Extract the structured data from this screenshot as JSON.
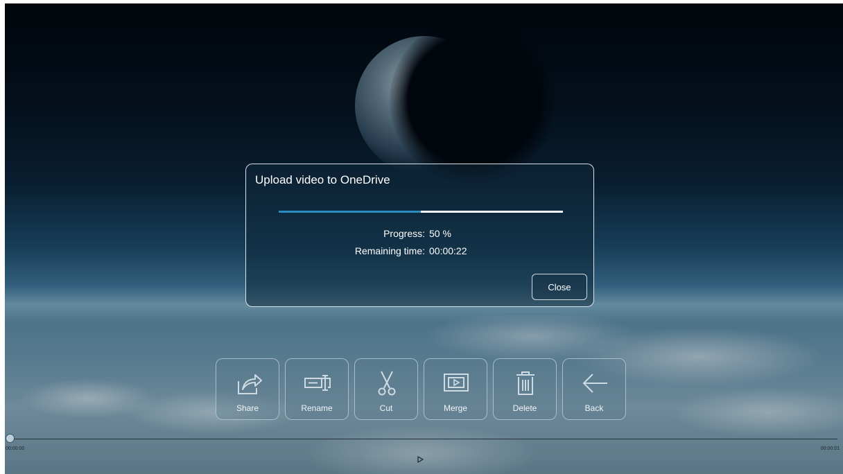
{
  "dialog": {
    "title": "Upload video to OneDrive",
    "progress_fraction": 0.5,
    "progress_label": "Progress:",
    "progress_value": "50 %",
    "remaining_label": "Remaining time:",
    "remaining_value": "00:00:22",
    "close_label": "Close"
  },
  "toolbar": {
    "items": [
      {
        "label": "Share",
        "icon": "share-icon"
      },
      {
        "label": "Rename",
        "icon": "rename-icon"
      },
      {
        "label": "Cut",
        "icon": "scissors-icon"
      },
      {
        "label": "Merge",
        "icon": "merge-icon"
      },
      {
        "label": "Delete",
        "icon": "trash-icon"
      },
      {
        "label": "Back",
        "icon": "arrow-left-icon"
      }
    ]
  },
  "timeline": {
    "start_time": "00:00:00",
    "end_time": "00:00:01",
    "position_fraction": 0
  },
  "colors": {
    "progress_accent": "#2a8cbf",
    "track": "#f4f6f8"
  }
}
